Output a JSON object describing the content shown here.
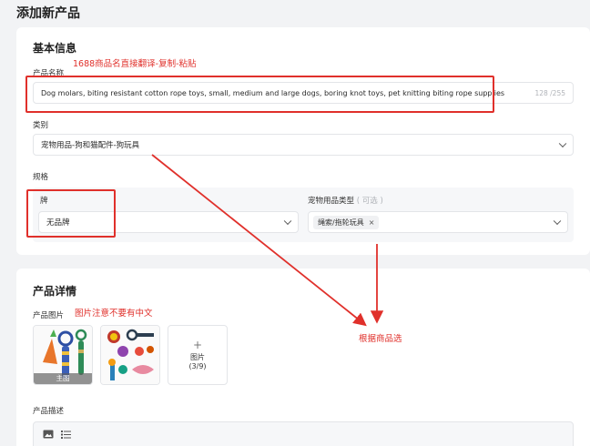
{
  "page_title": "添加新产品",
  "basic": {
    "title": "基本信息",
    "product_name_label": "产品名称",
    "product_name_value": "Dog molars, biting resistant cotton rope toys, small, medium and large dogs, boring knot toys, pet knitting biting rope supplies",
    "product_name_counter": "128 /255",
    "category_label": "类别",
    "category_value": "宠物用品-狗和猫配件-狗玩具",
    "specs_label": "规格",
    "brand_label": "牌",
    "brand_value": "无品牌",
    "pet_type_label": "宠物用品类型",
    "pet_type_optional": "( 可选 )",
    "pet_type_tag": "绳索/拖轮玩具",
    "pet_type_tag_remove": "×"
  },
  "details": {
    "title": "产品详情",
    "images_label": "产品图片",
    "main_badge": "主图",
    "upload_label": "图片",
    "upload_count": "(3/9)",
    "upload_plus": "+",
    "description_label": "产品描述"
  },
  "annotations": {
    "name_note": "1688商品名直接翻译-复制-粘贴",
    "image_note": "图片注意不要有中文",
    "category_note": "根据商品选"
  },
  "colors": {
    "annotation_red": "#e0302b",
    "page_background": "#f2f3f5",
    "card_background": "#ffffff"
  },
  "icons": [
    "chevron-down-icon",
    "image-icon",
    "list-icon",
    "plus-icon",
    "close-icon"
  ]
}
